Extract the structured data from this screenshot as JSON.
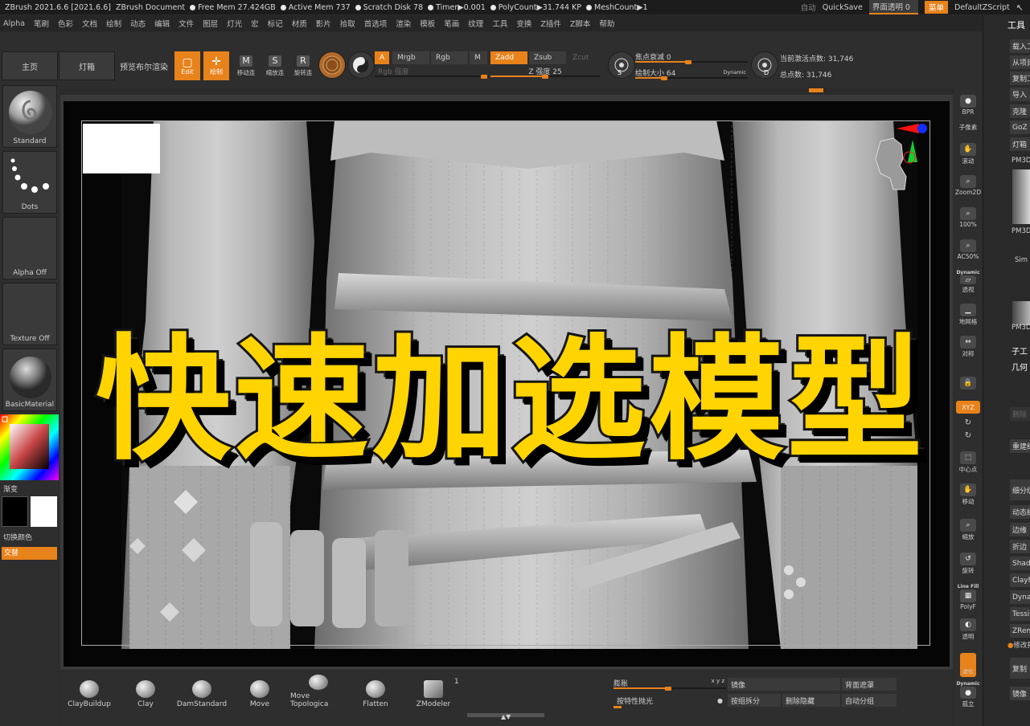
{
  "titlebar": {
    "app": "ZBrush 2021.6.6 [2021.6.6]",
    "doc": "ZBrush Document",
    "free_mem": "Free Mem 27.424GB",
    "active_mem": "Active Mem 737",
    "scratch": "Scratch Disk 78",
    "timer": "Timer▶0.001",
    "polycount": "PolyCount▶31.744 KP",
    "meshcount": "MeshCount▶1",
    "auto": "自动",
    "quicksave": "QuickSave",
    "transparency": "界面透明 0",
    "menu": "菜单",
    "script": "DefaultZScript"
  },
  "menubar": [
    "Alpha",
    "笔刷",
    "色彩",
    "文档",
    "绘制",
    "动态",
    "编辑",
    "文件",
    "图层",
    "灯光",
    "宏",
    "标记",
    "材质",
    "影片",
    "拾取",
    "首选项",
    "渲染",
    "模板",
    "笔画",
    "纹理",
    "工具",
    "变换",
    "Z插件",
    "Z脚本",
    "帮助"
  ],
  "topshelf": {
    "home": "主页",
    "lightbox": "灯箱",
    "bpr": "预览布尔渲染",
    "edit": "Edit",
    "draw": "绘制",
    "move": "移动连",
    "scale": "缩放连",
    "rotate": "旋转连",
    "a": "A",
    "mrgb": "Mrgb",
    "rgb": "Rgb",
    "m": "M",
    "rgb_intensity": "Rgb 强度",
    "zadd": "Zadd",
    "zsub": "Zsub",
    "zcut": "Zcut",
    "z_intensity": "Z 强度 25",
    "focal": "焦点衰减 0",
    "draw_size": "绘制大小 64",
    "dynamic": "Dynamic",
    "s": "S",
    "d": "D",
    "active_points": "当前激活点数: 31,746",
    "total_points": "总点数: 31,746"
  },
  "leftshelf": {
    "standard": "Standard",
    "dots": "Dots",
    "alpha_off": "Alpha Off",
    "texture_off": "Texture Off",
    "material": "BasicMaterial",
    "gradient": "渐变",
    "switch_color": "切换颜色",
    "alternate": "交替"
  },
  "canvas": {
    "headline": "快速加选模型",
    "colors": {
      "headline": "#ffd400",
      "accent": "#e8821b"
    }
  },
  "rightdock": [
    {
      "name": "bpr",
      "label": "BPR"
    },
    {
      "name": "subpixel",
      "label": "子像素"
    },
    {
      "name": "scroll",
      "label": "滚动"
    },
    {
      "name": "zoom2d",
      "label": "Zoom2D"
    },
    {
      "name": "100",
      "label": "100%"
    },
    {
      "name": "ac50",
      "label": "AC50%"
    },
    {
      "name": "persp",
      "label": "透视"
    },
    {
      "name": "floor",
      "label": "地网格"
    },
    {
      "name": "local",
      "label": "对称"
    },
    {
      "name": "lsym",
      "label": ""
    },
    {
      "name": "xyz",
      "label": "XYZ"
    },
    {
      "name": "frame",
      "label": "中心点"
    },
    {
      "name": "move",
      "label": "移动"
    },
    {
      "name": "zoom",
      "label": "缩放"
    },
    {
      "name": "rotate",
      "label": "旋转"
    },
    {
      "name": "linefill",
      "label": "PolyF"
    },
    {
      "name": "transp",
      "label": "透明"
    },
    {
      "name": "ghost",
      "label": "虚化"
    },
    {
      "name": "solo",
      "label": "孤立"
    }
  ],
  "dock_texts": {
    "linefill": "Line Fill",
    "dynamic": "Dynamic"
  },
  "toolpanel": {
    "title": "工具",
    "items": [
      "载入工",
      "从项目",
      "复制工",
      "导入",
      "克隆",
      "GoZ",
      "灯箱"
    ],
    "pm3d_1": "PM3D",
    "sim": "Sim",
    "pm3d_2": "PM3D",
    "subtool": "子工",
    "geometry": "几何",
    "lower": [
      "删除",
      "重建细",
      "细分级",
      "动态细",
      "边缘",
      "折边",
      "Shad",
      "ClayF",
      "Dyna",
      "Tessi",
      "ZRem",
      "修改拓",
      "复制",
      "镜像"
    ]
  },
  "bottomshelf": {
    "brushes": [
      "ClayBuildup",
      "Clay",
      "DamStandard",
      "Move",
      "Move Topologica",
      "Flatten",
      "ZModeler"
    ],
    "zmodeler_count": "1",
    "inflate": "膨胀",
    "xyz_tag": "x y z",
    "mirror": "镜像",
    "backface": "背面遮罩",
    "by_feature": "按特性抛光",
    "split_group": "按组拆分",
    "del_hidden": "删除隐藏",
    "auto_group": "自动分组"
  }
}
